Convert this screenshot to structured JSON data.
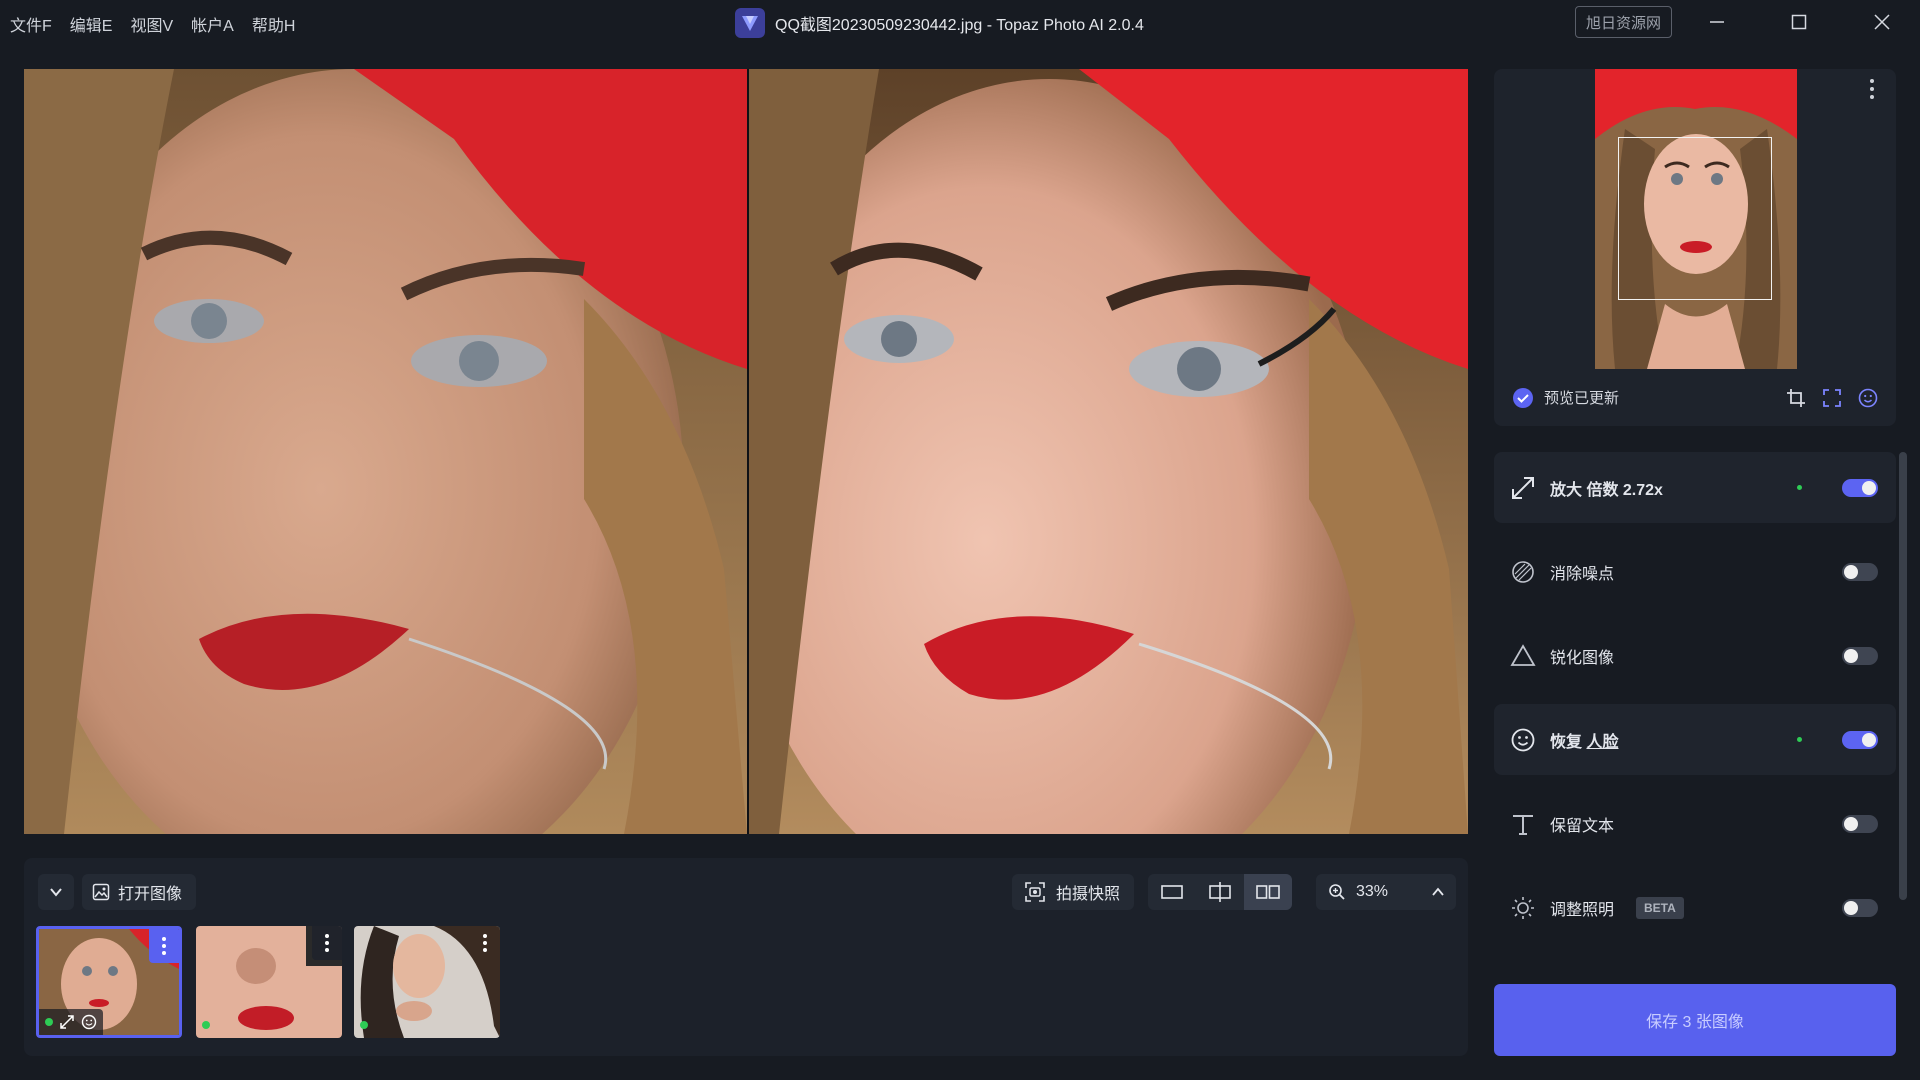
{
  "menu": [
    "文件F",
    "编辑E",
    "视图V",
    "帐户A",
    "帮助H"
  ],
  "window": {
    "title": "QQ截图20230509230442.jpg - Topaz Photo AI 2.0.4",
    "watermark": "旭日资源网"
  },
  "strip": {
    "open_label": "打开图像",
    "snapshot_label": "拍摄快照",
    "zoom": "33%"
  },
  "preview": {
    "status": "预览已更新"
  },
  "features": [
    {
      "label": "放大 倍数",
      "value": "2.72x",
      "icon": "upscale-icon",
      "enabled": true
    },
    {
      "label": "消除噪点",
      "icon": "denoise-icon",
      "enabled": false
    },
    {
      "label": "锐化图像",
      "icon": "sharpen-icon",
      "enabled": false
    },
    {
      "label": "恢复",
      "link": "人脸",
      "icon": "face-icon",
      "enabled": true
    },
    {
      "label": "保留文本",
      "icon": "text-icon",
      "enabled": false
    },
    {
      "label": "调整照明",
      "badge": "BETA",
      "icon": "light-icon",
      "enabled": false
    }
  ],
  "save_label": "保存 3 张图像",
  "colors": {
    "accent": "#5861ee",
    "background": "#171b22",
    "status_green": "#2ecc55"
  }
}
